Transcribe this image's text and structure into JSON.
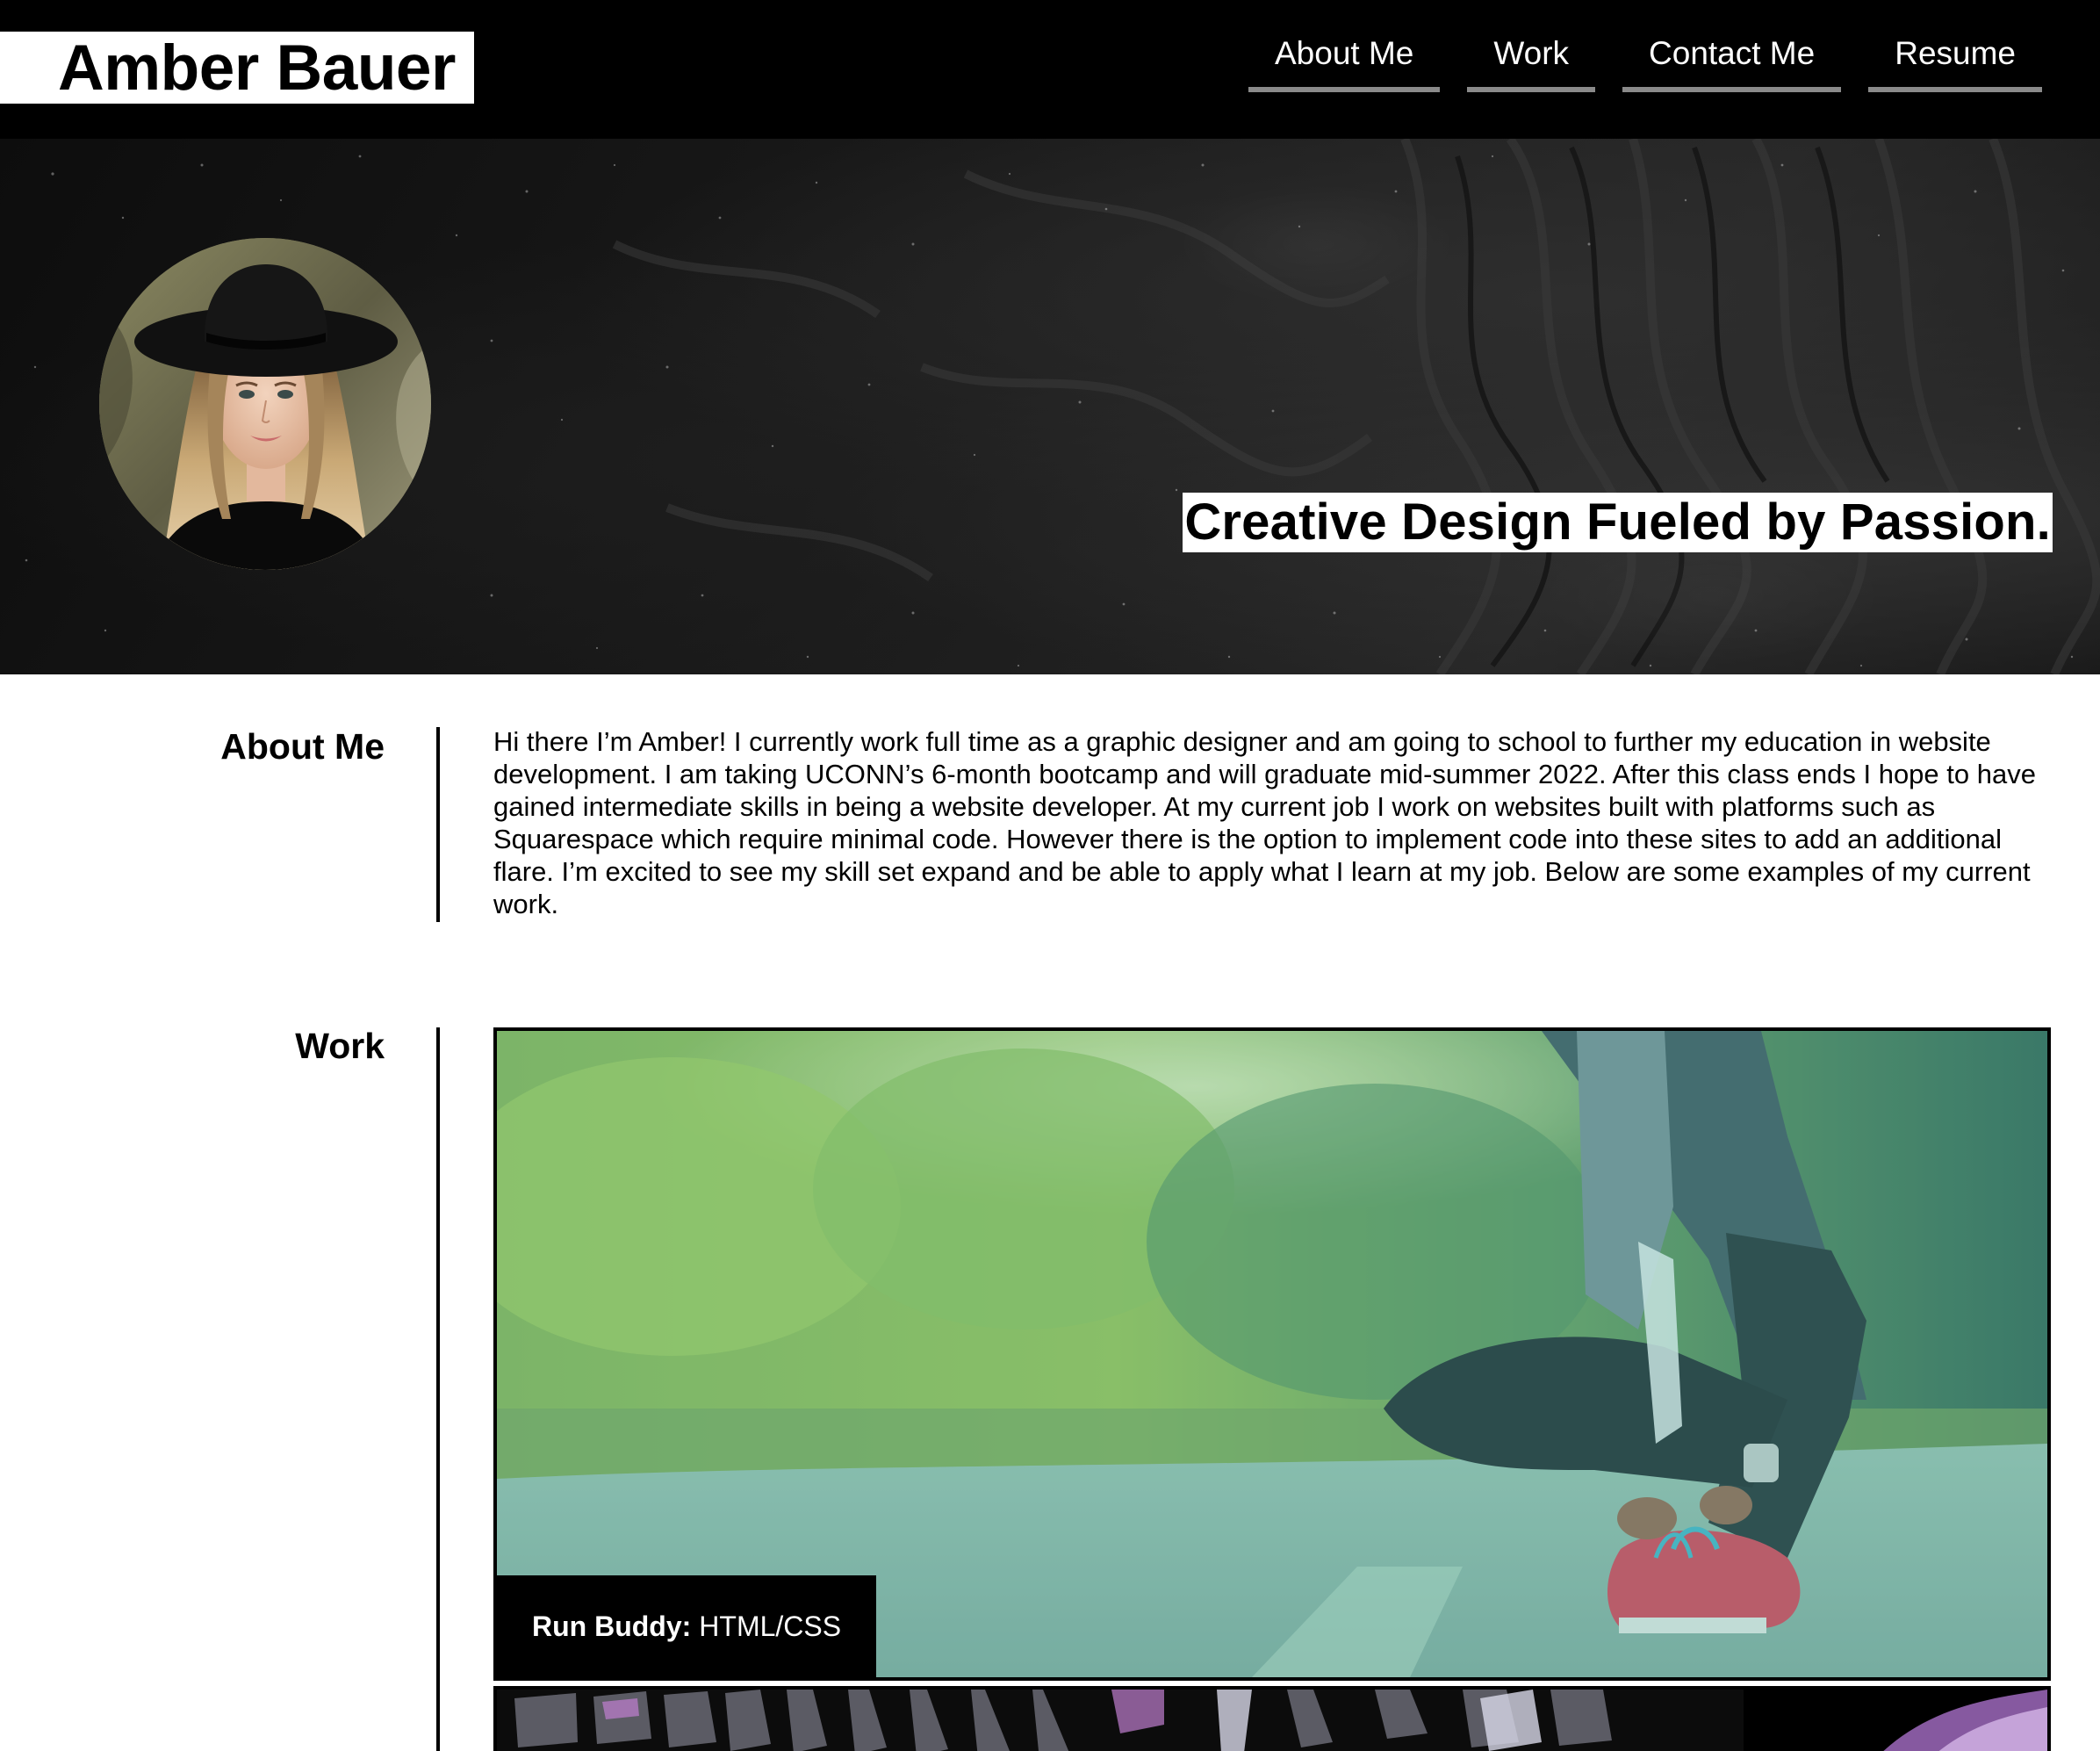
{
  "header": {
    "brand": "Amber Bauer",
    "nav": [
      {
        "label": "About Me"
      },
      {
        "label": "Work"
      },
      {
        "label": "Contact Me"
      },
      {
        "label": "Resume"
      }
    ]
  },
  "hero": {
    "tagline": "Creative Design Fueled by Passion."
  },
  "about": {
    "title": "About Me",
    "text": "Hi there I’m Amber! I currently work full time as a graphic designer and am going to school to further my education in website development. I am taking UCONN’s 6-month bootcamp and will graduate mid-summer 2022. After this class ends I hope to have gained intermediate skills in being a website developer. At my current job I work on websites built with platforms such as Squarespace which require minimal code. However there is the option to implement code into these sites to add an additional flare. I’m excited to see my skill set expand and be able to apply what I learn at my job. Below are some examples of my current work."
  },
  "work": {
    "title": "Work",
    "projects": [
      {
        "name": "Run Buddy:",
        "tech": "HTML/CSS"
      }
    ]
  },
  "colors": {
    "header_bg": "#000000",
    "nav_underline": "#8a8a8a",
    "page_bg": "#ffffff"
  }
}
